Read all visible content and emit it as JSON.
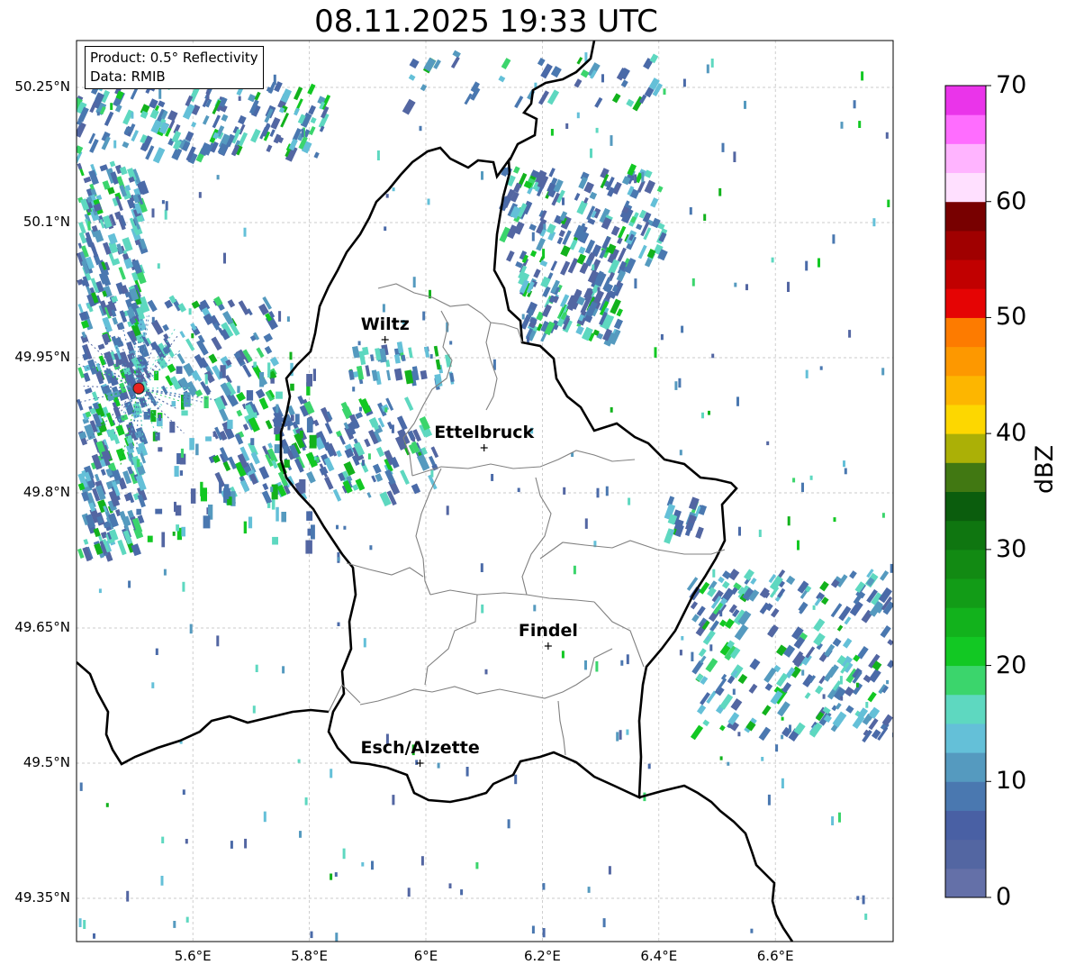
{
  "title": "08.11.2025 19:33 UTC",
  "info": {
    "product": "Product: 0.5° Reflectivity",
    "data": "Data: RMIB"
  },
  "lat_labels": [
    "50.25°N",
    "50.1°N",
    "49.95°N",
    "49.8°N",
    "49.65°N",
    "49.5°N",
    "49.35°N"
  ],
  "lon_labels": [
    "5.6°E",
    "5.8°E",
    "6°E",
    "6.2°E",
    "6.4°E",
    "6.6°E"
  ],
  "cities": [
    {
      "name": "Wiltz",
      "lon": 5.93,
      "lat": 49.97
    },
    {
      "name": "Ettelbruck",
      "lon": 6.1,
      "lat": 49.85
    },
    {
      "name": "Findel",
      "lon": 6.21,
      "lat": 49.63
    },
    {
      "name": "Esch/Alzette",
      "lon": 5.99,
      "lat": 49.5
    }
  ],
  "radar_site_color": "#e8231f",
  "colorbar": {
    "label": "dBZ",
    "ticks": [
      "0",
      "10",
      "20",
      "30",
      "40",
      "50",
      "60",
      "70"
    ],
    "colors": [
      "#6470a8",
      "#5366a2",
      "#4960a4",
      "#4a78b0",
      "#559abf",
      "#64c0d8",
      "#5ed8c0",
      "#3bd56c",
      "#12c823",
      "#12b21c",
      "#129c17",
      "#128a13",
      "#0f7610",
      "#0b5d0d",
      "#417812",
      "#abb006",
      "#fdd700",
      "#fdb600",
      "#fd9800",
      "#fd7b00",
      "#e50404",
      "#c10000",
      "#a00000",
      "#780000",
      "#ffe0ff",
      "#ffb4ff",
      "#ff6dff",
      "#ea34ea"
    ]
  }
}
